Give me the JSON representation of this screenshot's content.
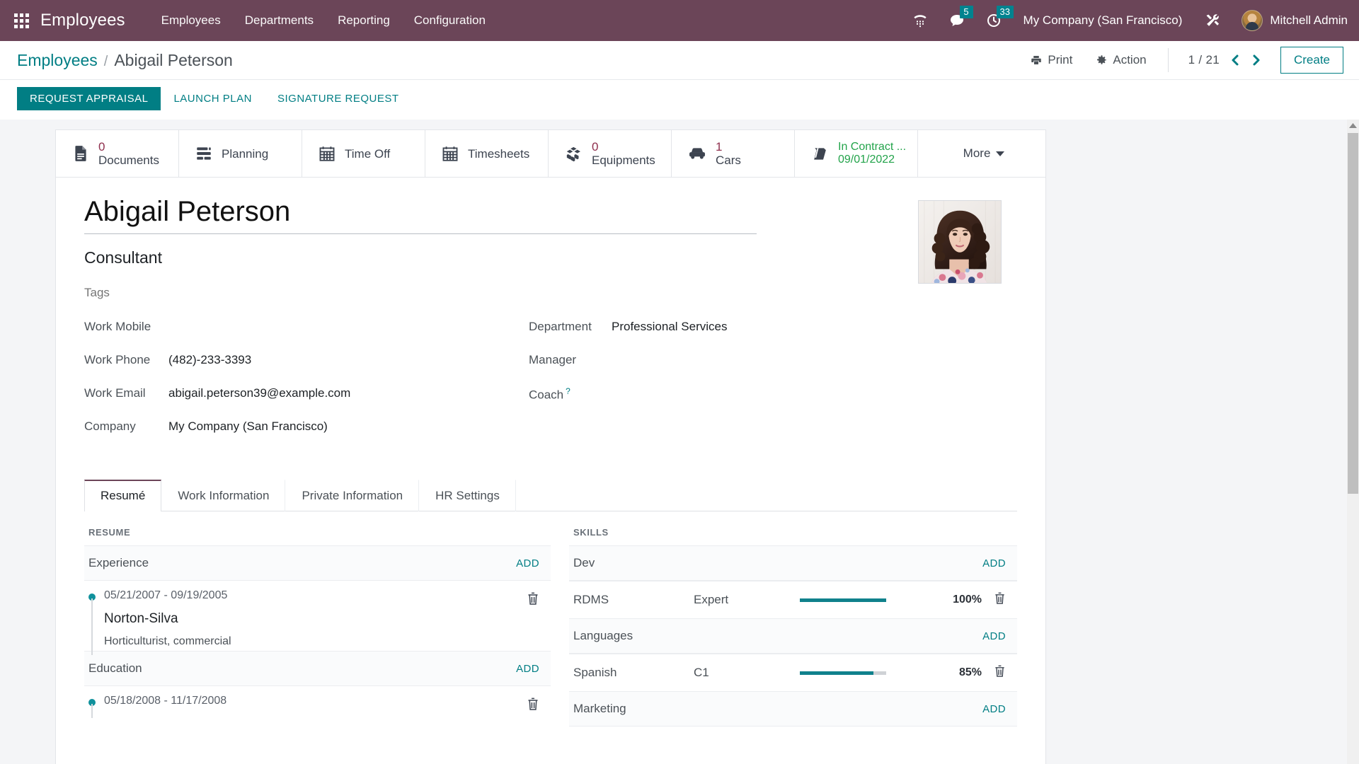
{
  "navbar": {
    "apps_icon": "apps-grid-icon",
    "brand": "Employees",
    "menu": [
      {
        "label": "Employees"
      },
      {
        "label": "Departments"
      },
      {
        "label": "Reporting"
      },
      {
        "label": "Configuration"
      }
    ],
    "icons": [
      {
        "name": "phone-dialpad-icon",
        "badge": ""
      },
      {
        "name": "messages-icon",
        "badge": "5"
      },
      {
        "name": "activities-clock-icon",
        "badge": "33"
      }
    ],
    "company": "My Company (San Francisco)",
    "debug_icon": "tools-icon",
    "user": "Mitchell Admin",
    "bg_color": "#6b4558",
    "badge_color": "#00838f"
  },
  "control_panel": {
    "breadcrumb_root": "Employees",
    "breadcrumb_sep": "/",
    "breadcrumb_current": "Abigail Peterson",
    "print_label": "Print",
    "action_label": "Action",
    "pager": "1 / 21",
    "prev_icon": "chevron-left-icon",
    "next_icon": "chevron-right-icon",
    "create_label": "Create",
    "accent_color": "#017e84"
  },
  "statusbar": {
    "buttons": [
      {
        "label": "REQUEST APPRAISAL",
        "primary": true
      },
      {
        "label": "LAUNCH PLAN",
        "primary": false
      },
      {
        "label": "SIGNATURE REQUEST",
        "primary": false
      }
    ]
  },
  "stat_buttons": [
    {
      "icon": "document-icon",
      "value": "0",
      "label": "Documents"
    },
    {
      "icon": "planning-icon",
      "value": "",
      "label": "Planning"
    },
    {
      "icon": "calendar-icon",
      "value": "",
      "label": "Time Off"
    },
    {
      "icon": "calendar-icon",
      "value": "",
      "label": "Timesheets"
    },
    {
      "icon": "boxes-icon",
      "value": "0",
      "label": "Equipments"
    },
    {
      "icon": "car-icon",
      "value": "1",
      "label": "Cars"
    },
    {
      "icon": "contract-book-icon",
      "value": "In Contract ...",
      "label": "09/01/2022",
      "green": true
    }
  ],
  "more_button": {
    "label": "More",
    "icon": "caret-down-icon"
  },
  "employee": {
    "name": "Abigail Peterson",
    "job_title": "Consultant",
    "tags_placeholder": "Tags",
    "avatar_name": "employee-photo",
    "left_fields": [
      {
        "label": "Work Mobile",
        "value": ""
      },
      {
        "label": "Work Phone",
        "value": "(482)-233-3393"
      },
      {
        "label": "Work Email",
        "value": "abigail.peterson39@example.com"
      },
      {
        "label": "Company",
        "value": "My Company (San Francisco)"
      }
    ],
    "right_fields": [
      {
        "label": "Department",
        "value": "Professional Services",
        "help": false
      },
      {
        "label": "Manager",
        "value": "",
        "help": false
      },
      {
        "label": "Coach",
        "value": "",
        "help": true
      }
    ]
  },
  "tabs": [
    {
      "label": "Resumé",
      "active": true
    },
    {
      "label": "Work Information",
      "active": false
    },
    {
      "label": "Private Information",
      "active": false
    },
    {
      "label": "HR Settings",
      "active": false
    }
  ],
  "resume": {
    "section_title": "RESUME",
    "add_label": "ADD",
    "groups": [
      {
        "name": "Experience",
        "lines": [
          {
            "dates": "05/21/2007 - 09/19/2005",
            "title": "Norton-Silva",
            "description": "Horticulturist, commercial",
            "delete_icon": "trash-icon"
          }
        ]
      },
      {
        "name": "Education",
        "lines": [
          {
            "dates": "05/18/2008 - 11/17/2008",
            "title": "",
            "description": "",
            "delete_icon": "trash-icon"
          }
        ]
      }
    ]
  },
  "skills": {
    "section_title": "SKILLS",
    "add_label": "ADD",
    "bar_color": "#10818c",
    "rows": [
      {
        "type": "group",
        "name": "Dev"
      },
      {
        "type": "skill",
        "name": "RDMS",
        "level": "Expert",
        "percent": 100,
        "percent_label": "100%",
        "delete_icon": "trash-icon"
      },
      {
        "type": "group",
        "name": "Languages"
      },
      {
        "type": "skill",
        "name": "Spanish",
        "level": "C1",
        "percent": 85,
        "percent_label": "85%",
        "delete_icon": "trash-icon"
      },
      {
        "type": "group",
        "name": "Marketing"
      }
    ]
  },
  "scrollbar": {
    "up_icon": "scroll-up-arrow-icon"
  }
}
